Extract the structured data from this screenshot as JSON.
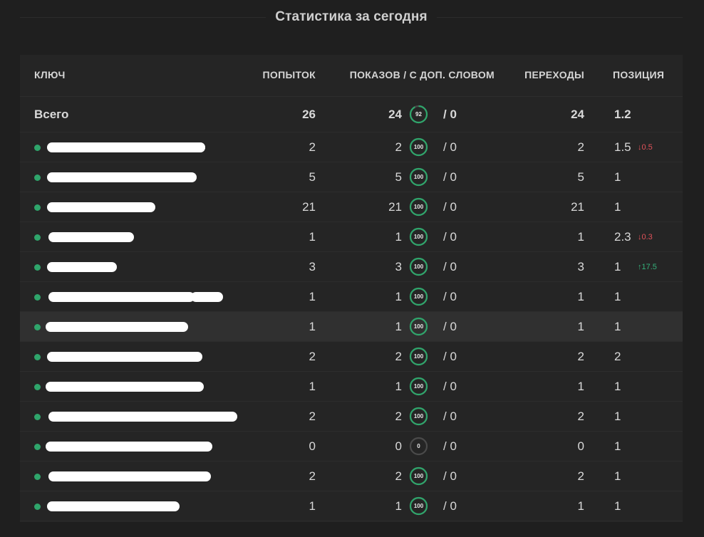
{
  "title": "Статистика за сегодня",
  "colors": {
    "positive": "#35b07a",
    "negative": "#e0525a",
    "ring_full": "#2fa56b",
    "ring_empty": "#4a4a4a"
  },
  "table": {
    "headers": {
      "key": "КЛЮЧ",
      "attempts": "ПОПЫТОК",
      "impressions": "ПОКАЗОВ / С ДОП. СЛОВОМ",
      "clicks": "ПЕРЕХОДЫ",
      "position": "ПОЗИЦИЯ"
    },
    "total": {
      "label": "Всего",
      "attempts": "26",
      "impressions": "24",
      "ring_percent": 92,
      "ring_label": "92",
      "extra": "/ 0",
      "clicks": "24",
      "position": "1.2"
    },
    "rows": [
      {
        "attempts": "2",
        "impressions": "2",
        "ring_percent": 100,
        "ring_label": "100",
        "extra": "/ 0",
        "clicks": "2",
        "position": "1.5",
        "delta": "0.5",
        "delta_dir": "down",
        "delta_arrow": "↓"
      },
      {
        "attempts": "5",
        "impressions": "5",
        "ring_percent": 100,
        "ring_label": "100",
        "extra": "/ 0",
        "clicks": "5",
        "position": "1"
      },
      {
        "attempts": "21",
        "impressions": "21",
        "ring_percent": 100,
        "ring_label": "100",
        "extra": "/ 0",
        "clicks": "21",
        "position": "1"
      },
      {
        "attempts": "1",
        "impressions": "1",
        "ring_percent": 100,
        "ring_label": "100",
        "extra": "/ 0",
        "clicks": "1",
        "position": "2.3",
        "delta": "0.3",
        "delta_dir": "down",
        "delta_arrow": "↓"
      },
      {
        "attempts": "3",
        "impressions": "3",
        "ring_percent": 100,
        "ring_label": "100",
        "extra": "/ 0",
        "clicks": "3",
        "position": "1",
        "delta": "17.5",
        "delta_dir": "up",
        "delta_arrow": "↑"
      },
      {
        "attempts": "1",
        "impressions": "1",
        "ring_percent": 100,
        "ring_label": "100",
        "extra": "/ 0",
        "clicks": "1",
        "position": "1"
      },
      {
        "attempts": "1",
        "impressions": "1",
        "ring_percent": 100,
        "ring_label": "100",
        "extra": "/ 0",
        "clicks": "1",
        "position": "1",
        "highlighted": true
      },
      {
        "attempts": "2",
        "impressions": "2",
        "ring_percent": 100,
        "ring_label": "100",
        "extra": "/ 0",
        "clicks": "2",
        "position": "2"
      },
      {
        "attempts": "1",
        "impressions": "1",
        "ring_percent": 100,
        "ring_label": "100",
        "extra": "/ 0",
        "clicks": "1",
        "position": "1"
      },
      {
        "attempts": "2",
        "impressions": "2",
        "ring_percent": 100,
        "ring_label": "100",
        "extra": "/ 0",
        "clicks": "2",
        "position": "1"
      },
      {
        "attempts": "0",
        "impressions": "0",
        "ring_percent": 0,
        "ring_label": "0",
        "extra": "/ 0",
        "clicks": "0",
        "position": "1"
      },
      {
        "attempts": "2",
        "impressions": "2",
        "ring_percent": 100,
        "ring_label": "100",
        "extra": "/ 0",
        "clicks": "2",
        "position": "1"
      },
      {
        "attempts": "1",
        "impressions": "1",
        "ring_percent": 100,
        "ring_label": "100",
        "extra": "/ 0",
        "clicks": "1",
        "position": "1"
      }
    ]
  }
}
